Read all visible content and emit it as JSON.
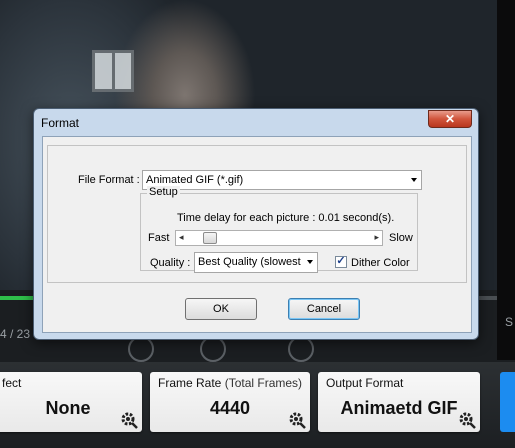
{
  "background": {
    "frame_counter": "4 / 23",
    "side_letter": "S"
  },
  "dialog": {
    "title": "Format",
    "close_label": "✕",
    "file_format_label": "File Format :",
    "file_format_value": "Animated GIF (*.gif)",
    "setup_legend": "Setup",
    "time_delay_text": "Time delay for each picture  : 0.01 second(s).",
    "fast_label": "Fast",
    "slow_label": "Slow",
    "slider_position": 0.08,
    "quality_label": "Quality :",
    "quality_value": "Best Quality (slowest",
    "dither_label": "Dither Color",
    "dither_checked": true,
    "ok_label": "OK",
    "cancel_label": "Cancel"
  },
  "cards": {
    "effect": {
      "title": "fect",
      "value": "None"
    },
    "frame_rate": {
      "title": "Frame Rate",
      "title_sub": "(Total Frames)",
      "value": "4440"
    },
    "output_format": {
      "title": "Output Format",
      "value": "Animaetd GIF"
    }
  },
  "colors": {
    "progress": "#2fbf4a",
    "accent_blue": "#1c8cf0",
    "close_red": "#c8472e"
  }
}
